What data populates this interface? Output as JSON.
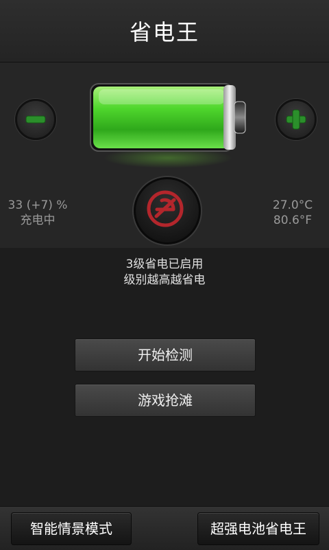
{
  "header": {
    "title": "省电王"
  },
  "battery": {
    "percent": "33 (+7) %",
    "charge_state": "充电中",
    "temp_c": "27.0°C",
    "temp_f": "80.6°F",
    "level_fraction": 0.33
  },
  "icons": {
    "minus": "minus-icon",
    "plus": "plus-icon",
    "battery": "battery-icon",
    "eco": "power-saving-e-icon"
  },
  "status": {
    "line1": "3级省电已启用",
    "line2": "级别越高越省电"
  },
  "actions": {
    "detect": "开始检测",
    "game": "游戏抢滩"
  },
  "footer": {
    "tab1": "智能情景模式",
    "tab2": "超强电池省电王"
  },
  "colors": {
    "battery_green": "#3fcf2a",
    "accent_green": "#2e9b2e",
    "eco_red": "#b3262c"
  }
}
